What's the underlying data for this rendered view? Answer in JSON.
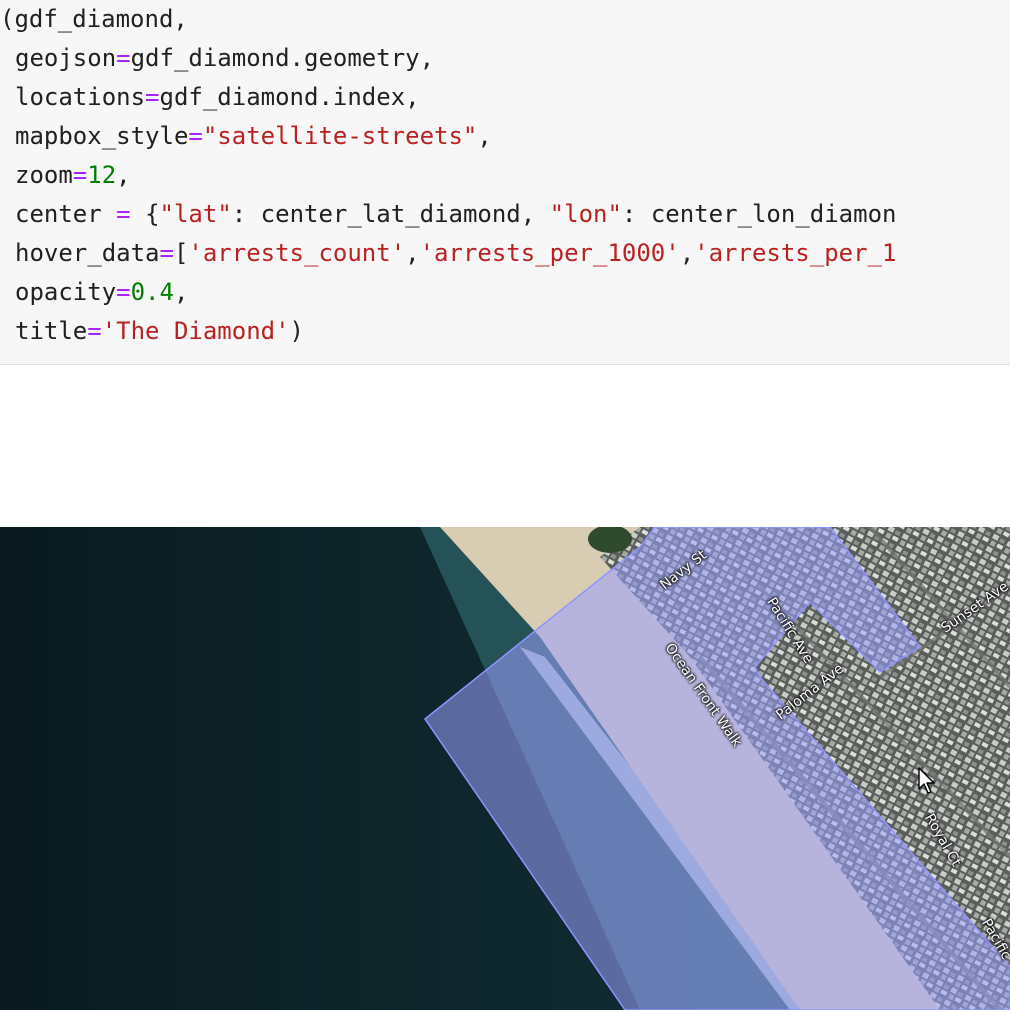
{
  "code": {
    "line1": {
      "open": "(",
      "var": "gdf_diamond",
      "comma": ","
    },
    "line2": {
      "key": "geojson",
      "eq": "=",
      "val": "gdf_diamond.geometry",
      "comma": ","
    },
    "line3": {
      "key": "locations",
      "eq": "=",
      "val": "gdf_diamond.index",
      "comma": ","
    },
    "line4": {
      "key": "mapbox_style",
      "eq": "=",
      "val": "\"satellite-streets\"",
      "comma": ","
    },
    "line5": {
      "key": "zoom",
      "eq": "=",
      "val": "12",
      "comma": ","
    },
    "line6": {
      "key": "center",
      "eq": " = ",
      "brace": "{",
      "k1": "\"lat\"",
      "colon1": ": ",
      "v1": "center_lat_diamond",
      "sep": ", ",
      "k2": "\"lon\"",
      "colon2": ": ",
      "v2": "center_lon_diamon"
    },
    "line7": {
      "key": "hover_data",
      "eq": "=",
      "bracket": "[",
      "s1": "'arrests_count'",
      "c1": ",",
      "s2": "'arrests_per_1000'",
      "c2": ",",
      "s3": "'arrests_per_1"
    },
    "line8": {
      "key": "opacity",
      "eq": "=",
      "val": "0.4",
      "comma": ","
    },
    "line9": {
      "key": "title",
      "eq": "=",
      "val": "'The Diamond'",
      "close": ")"
    }
  },
  "map": {
    "streets": {
      "navy_st": "Navy St",
      "pacific_ave": "Pacific Ave",
      "ocean_front_walk": "Ocean Front Walk",
      "paloma_ave": "Paloma Ave",
      "sunset_ave": "Sunset Ave",
      "royal_ct": "Royal Ct",
      "pacific_ave_2": "Pacific"
    },
    "polygon_color": "#9aa0ff",
    "polygon_opacity": 0.4
  }
}
